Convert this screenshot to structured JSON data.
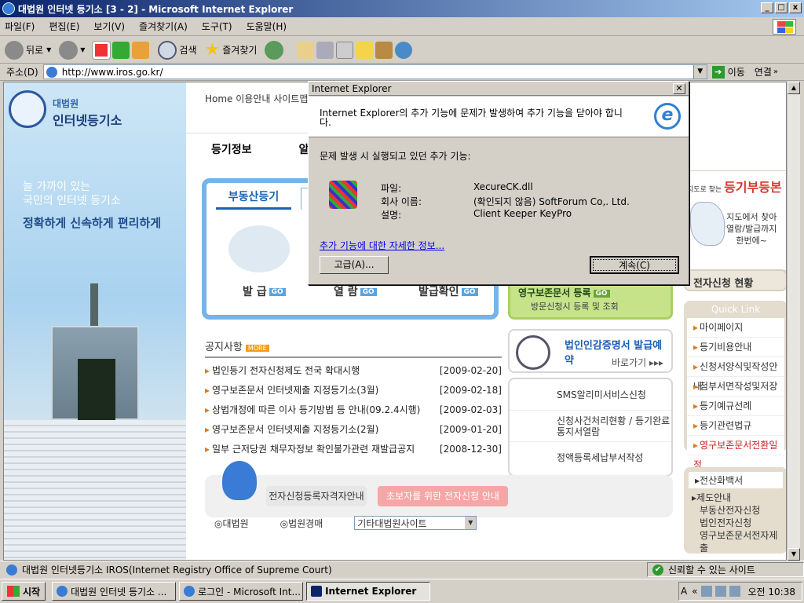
{
  "window": {
    "title": "대법원 인터넷 등기소 [3 - 2] - Microsoft Internet Explorer",
    "controls": [
      "_",
      "□",
      "x"
    ]
  },
  "menu": [
    "파일(F)",
    "편집(E)",
    "보기(V)",
    "즐겨찾기(A)",
    "도구(T)",
    "도움말(H)"
  ],
  "toolbar": {
    "back": "뒤로",
    "search": "검색",
    "favorites": "즐겨찾기"
  },
  "address": {
    "label": "주소(D)",
    "url": "http://www.iros.go.kr/",
    "go": "이동",
    "links": "연결"
  },
  "site": {
    "logo_top": "대법원",
    "logo_bottom": "인터넷등기소",
    "top_nav": "Home 이용안내 사이트맵",
    "main_nav": [
      "등기정보",
      "알림"
    ],
    "slogan1": "늘 가까이 있는",
    "slogan2": "국민의 인터넷 등기소",
    "slogan3": "정확하게 신속하게 편리하게",
    "tab_realestate": "부동산등기",
    "services": [
      "발 급",
      "열 람",
      "발급확인"
    ],
    "go_badge": "GO",
    "green_title": "영구보존문서 등록",
    "green_sub": "방문신청시 등록 및 조회",
    "notice_title": "공지사항",
    "more": "MORE",
    "notices": [
      {
        "title": "법인등기 전자신청제도 전국 확대시행",
        "date": "[2009-02-20]"
      },
      {
        "title": "영구보존문서 인터넷제출 지정등기소(3월)",
        "date": "[2009-02-18]"
      },
      {
        "title": "상법개정에 따른 이사 등기방법 등 안내(09.2.4시행)",
        "date": "[2009-02-03]"
      },
      {
        "title": "영구보존문서 인터넷제출 지정등기소(2월)",
        "date": "[2009-01-20]"
      },
      {
        "title": "일부 근저당권 채무자정보 확인불가관련 재발급공지",
        "date": "[2008-12-30]"
      }
    ],
    "reserve_title": "법인인감증명서 발급예약",
    "reserve_go": "바로가기 ▸▸▸",
    "mid_items": [
      "SMS알리미서비스신청",
      "신청사건처리현황 / 등기완료통지서열람",
      "정액등록세납부서작성"
    ],
    "btn_qualify": "전자신청등록자격자안내",
    "btn_beginner": "초보자를 위한 전자신청 안내",
    "foot_links": [
      "대법원",
      "법원경매"
    ],
    "foot_select": "기타대법원사이트",
    "map_tag": "지도로 찾는",
    "map_title": "등기부등본",
    "map_text": [
      "지도에서 찾아",
      "열람/발급까지",
      "한번에~"
    ],
    "e_status": "전자신청 현황",
    "quick_title": "Quick Link",
    "quick_links": [
      "마이페이지",
      "등기비용안내",
      "신청서양식및작성안내",
      "첨부서면작성및저장",
      "등기예규선례",
      "등기관련법규",
      "영구보존문서전환일정"
    ],
    "info_title": "▸전산화백서",
    "info_sub": "▸제도안내",
    "info_items": [
      "부동산전자신청",
      "법인전자신청",
      "영구보존문서전자제출"
    ]
  },
  "dialog": {
    "title": "Internet Explorer",
    "header": "Internet Explorer의 추가 기능에 문제가 발생하여 추가 기능을 닫아야 합니다.",
    "label": "문제 발생 시 실행되고 있던 추가 기능:",
    "file_k": "파일:",
    "file_v": "XecureCK.dll",
    "company_k": "회사 이름:",
    "company_v": "(확인되지 않음) SoftForum Co,. Ltd.",
    "desc_k": "설명:",
    "desc_v": "Client Keeper KeyPro",
    "link": "추가 기능에 대한 자세한 정보...",
    "advanced": "고급(A)...",
    "continue": "계속(C)"
  },
  "status": {
    "text": "대법원 인터넷등기소 IROS(Internet Registry Office of Supreme Court)",
    "zone": "신뢰할 수 있는 사이트"
  },
  "taskbar": {
    "start": "시작",
    "tasks": [
      "대법원 인터넷 등기소 ...",
      "로그인 - Microsoft Int...",
      "Internet Explorer"
    ],
    "clock": "오전 10:38"
  }
}
